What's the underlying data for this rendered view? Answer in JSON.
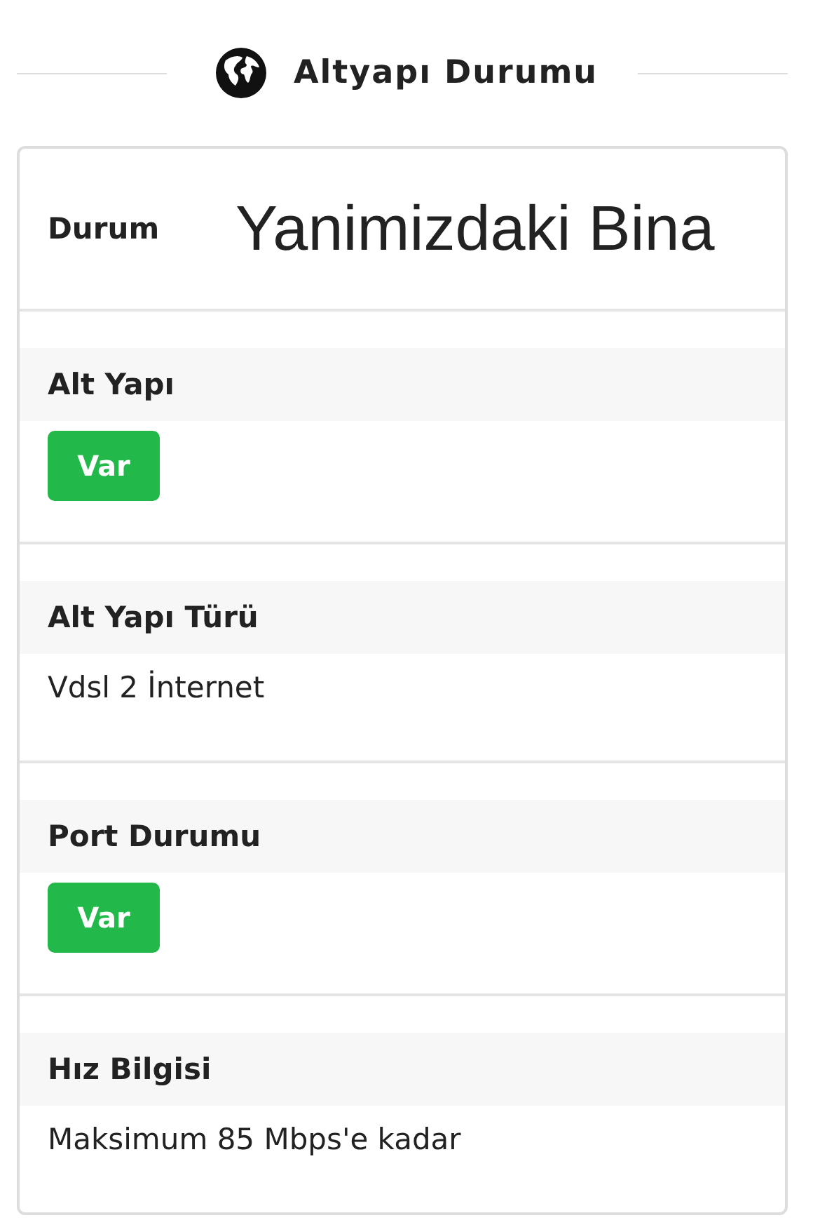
{
  "header": {
    "title": "Altyapı Durumu"
  },
  "summary": {
    "label": "Durum",
    "value": "Yanimizdaki Bina"
  },
  "sections": [
    {
      "label": "Alt Yapı",
      "kind": "badge",
      "value": "Var"
    },
    {
      "label": "Alt Yapı Türü",
      "kind": "text",
      "value": "Vdsl 2 İnternet"
    },
    {
      "label": "Port Durumu",
      "kind": "badge",
      "value": "Var"
    },
    {
      "label": "Hız Bilgisi",
      "kind": "text",
      "value": "Maksimum 85 Mbps'e kadar"
    }
  ]
}
